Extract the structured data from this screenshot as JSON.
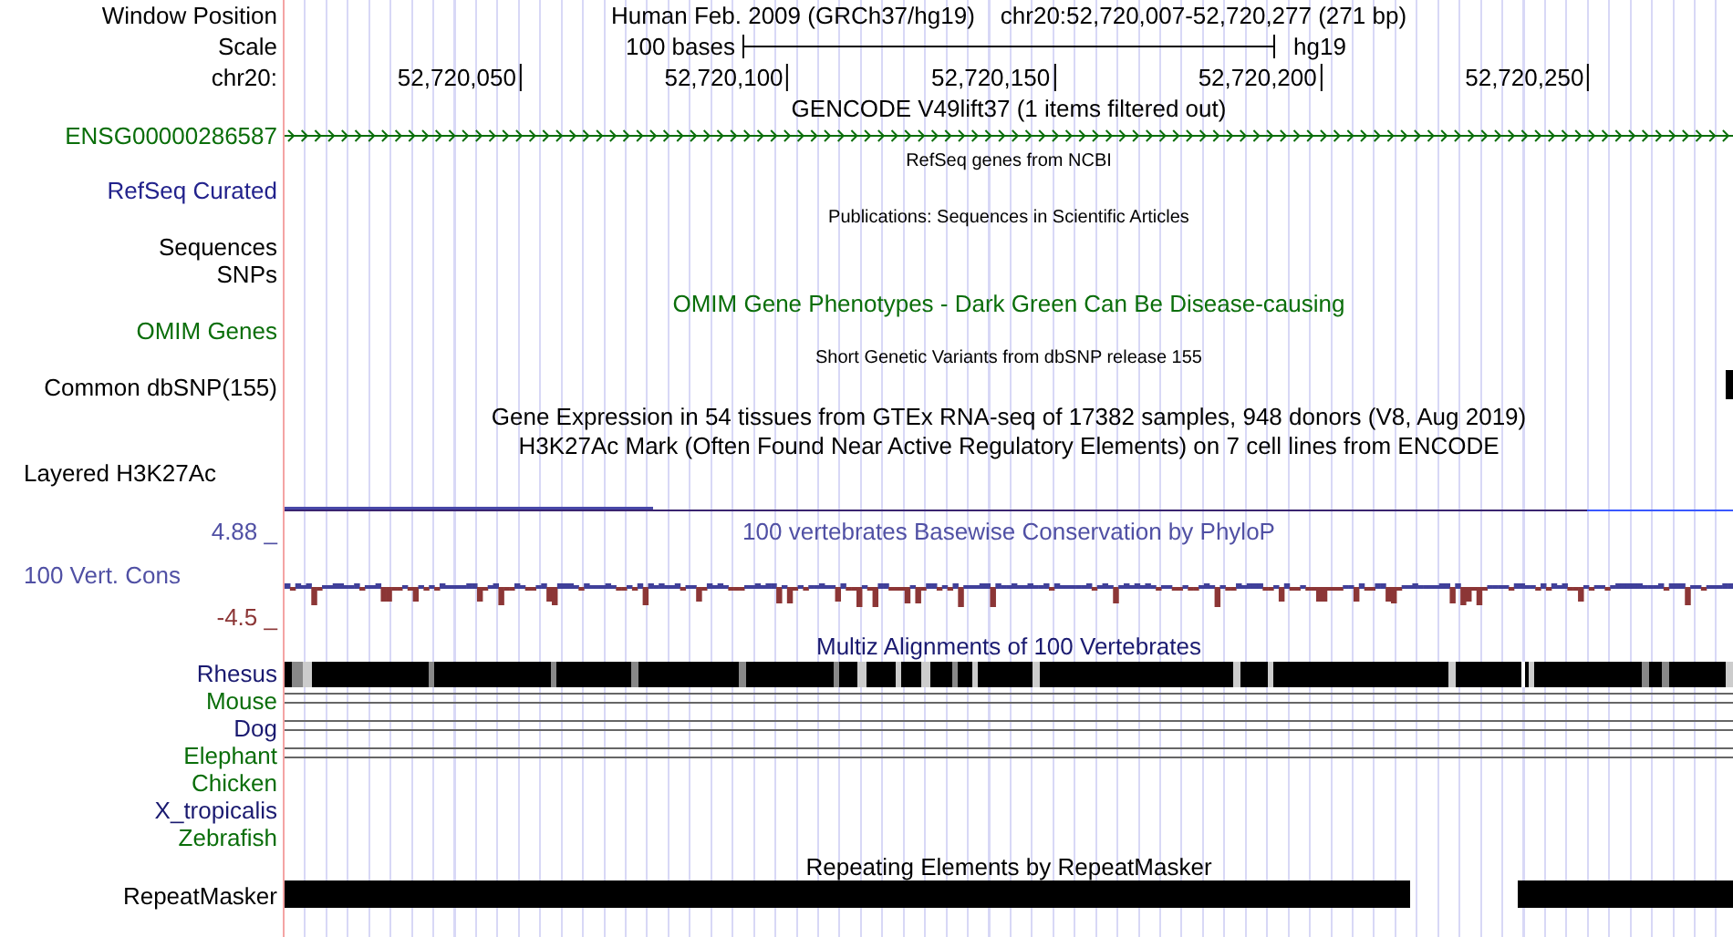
{
  "tracks": [
    {
      "kind": "position",
      "label": "Window Position",
      "color": "#000000",
      "assembly": "Human Feb. 2009 (GRCh37/hg19)",
      "position": "chr20:52,720,007-52,720,277 (271 bp)"
    },
    {
      "kind": "scale",
      "label": "Scale",
      "color": "#000000",
      "span": "100 bases",
      "genome": "hg19"
    },
    {
      "kind": "ruler",
      "label": "chr20:",
      "color": "#000000",
      "ticks": [
        "52,720,050",
        "52,720,100",
        "52,720,150",
        "52,720,200",
        "52,720,250"
      ]
    },
    {
      "kind": "title",
      "text": "GENCODE V49lift37 (1 items filtered out)",
      "color": "#000000"
    },
    {
      "kind": "gene",
      "label": "ENSG00000286587",
      "color": "#0a6e0a"
    },
    {
      "kind": "small_title",
      "text": "RefSeq genes from NCBI",
      "color": "#000000"
    },
    {
      "kind": "label",
      "label": "RefSeq Curated",
      "color": "#22228c",
      "marker": false
    },
    {
      "kind": "small_title",
      "text": "Publications: Sequences in Scientific Articles",
      "color": "#000000"
    },
    {
      "kind": "label",
      "label": "Sequences",
      "color": "#000000",
      "marker": false
    },
    {
      "kind": "label",
      "label": "SNPs",
      "color": "#000000",
      "marker": false
    },
    {
      "kind": "title",
      "text": "OMIM Gene Phenotypes - Dark Green Can Be Disease-causing",
      "color": "#0a6e0a"
    },
    {
      "kind": "label",
      "label": "OMIM Genes",
      "color": "#0a6e0a",
      "marker": false
    },
    {
      "kind": "small_title",
      "text": "Short Genetic Variants from dbSNP release 155",
      "color": "#000000"
    },
    {
      "kind": "label",
      "label": "Common dbSNP(155)",
      "color": "#000000",
      "marker": true
    },
    {
      "kind": "title",
      "text": "Gene Expression in 54 tissues from GTEx RNA-seq of 17382 samples, 948 donors (V8, Aug 2019)",
      "color": "#000000"
    },
    {
      "kind": "title",
      "text": "H3K27Ac Mark (Often Found Near Active Regulatory Elements) on 7 cell lines from ENCODE",
      "color": "#000000"
    },
    {
      "kind": "signal",
      "label": "Layered H3K27Ac",
      "color": "#000000"
    },
    {
      "kind": "wiggle_max",
      "label": "4.88 _",
      "color": "#5050a4",
      "title": "100 vertebrates Basewise Conservation by PhyloP"
    },
    {
      "kind": "wiggle",
      "label": "100 Vert. Cons",
      "color": "#5050a4"
    },
    {
      "kind": "wiggle_min",
      "label": "-4.5 _",
      "color": "#8c3636"
    },
    {
      "kind": "title",
      "text": "Multiz Alignments of 100 Vertebrates",
      "color": "#1a1a70"
    },
    {
      "kind": "species_blocks",
      "label": "Rhesus",
      "color": "#1a1a70"
    },
    {
      "kind": "species_lines",
      "label": "Mouse",
      "color": "#0a6e0a"
    },
    {
      "kind": "species_lines",
      "label": "Dog",
      "color": "#1a1a70"
    },
    {
      "kind": "species_lines",
      "label": "Elephant",
      "color": "#0a6e0a"
    },
    {
      "kind": "species",
      "label": "Chicken",
      "color": "#0a6e0a"
    },
    {
      "kind": "species",
      "label": "X_tropicalis",
      "color": "#1a1a70"
    },
    {
      "kind": "species",
      "label": "Zebrafish",
      "color": "#0a6e0a"
    },
    {
      "kind": "title",
      "text": "Repeating Elements by RepeatMasker",
      "color": "#000000"
    },
    {
      "kind": "repeat",
      "label": "RepeatMasker",
      "color": "#000000"
    }
  ]
}
